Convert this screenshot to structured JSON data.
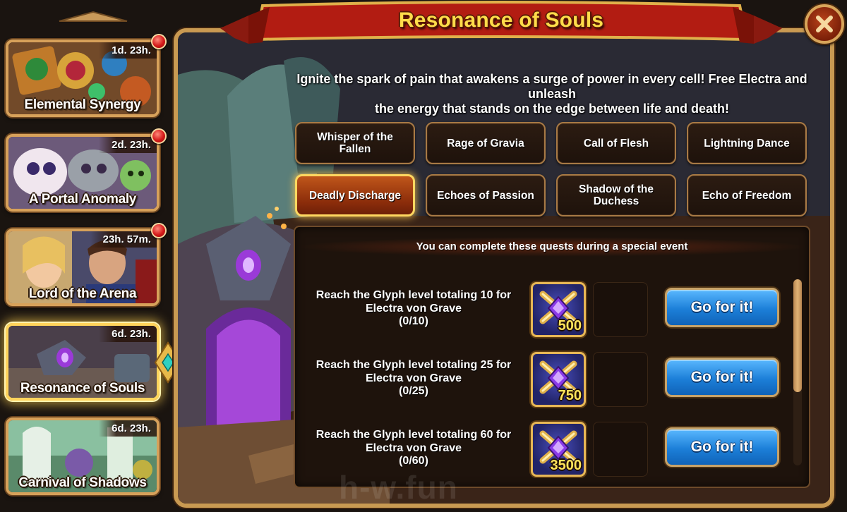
{
  "sidebar": {
    "events": [
      {
        "title": "Elemental Synergy",
        "timer": "1d. 23h.",
        "has_notification": true
      },
      {
        "title": "A Portal Anomaly",
        "timer": "2d. 23h.",
        "has_notification": true
      },
      {
        "title": "Lord of the Arena",
        "timer": "23h. 57m.",
        "has_notification": true
      },
      {
        "title": "Resonance of Souls",
        "timer": "6d. 23h.",
        "has_notification": false,
        "active": true
      },
      {
        "title": "Carnival of Shadows",
        "timer": "6d. 23h.",
        "has_notification": false
      }
    ]
  },
  "panel": {
    "title": "Resonance of Souls",
    "description_line1": "Ignite the spark of pain that awakens a surge of power in every cell! Free Electra and unleash",
    "description_line2": "the energy that stands on the edge between life and death!",
    "tabs": [
      {
        "label": "Whisper of the Fallen"
      },
      {
        "label": "Rage of Gravia"
      },
      {
        "label": "Call of Flesh"
      },
      {
        "label": "Lightning Dance"
      },
      {
        "label": "Deadly Discharge",
        "selected": true
      },
      {
        "label": "Echoes of Passion"
      },
      {
        "label": "Shadow of the Duchess"
      },
      {
        "label": "Echo of Freedom"
      }
    ],
    "quests_header": "You can complete these quests during a special event",
    "quests": [
      {
        "line1": "Reach the Glyph level totaling 10 for",
        "line2": "Electra von Grave",
        "progress": "(0/10)",
        "reward": "500",
        "button": "Go for it!"
      },
      {
        "line1": "Reach the Glyph level totaling 25 for",
        "line2": "Electra von Grave",
        "progress": "(0/25)",
        "reward": "750",
        "button": "Go for it!"
      },
      {
        "line1": "Reach the Glyph level totaling 60 for",
        "line2": "Electra von Grave",
        "progress": "(0/60)",
        "reward": "3500",
        "button": "Go for it!"
      }
    ],
    "close_icon": "close-icon",
    "reward_icon": "crossed-swords-gem-icon"
  },
  "watermark": "h-w.fun",
  "colors": {
    "title_gold": "#ffdc4a",
    "banner_red": "#b21c12",
    "frame_gold": "#c99a52",
    "button_blue": "#1c7fd8",
    "tab_selected_orange": "#c0561a"
  }
}
